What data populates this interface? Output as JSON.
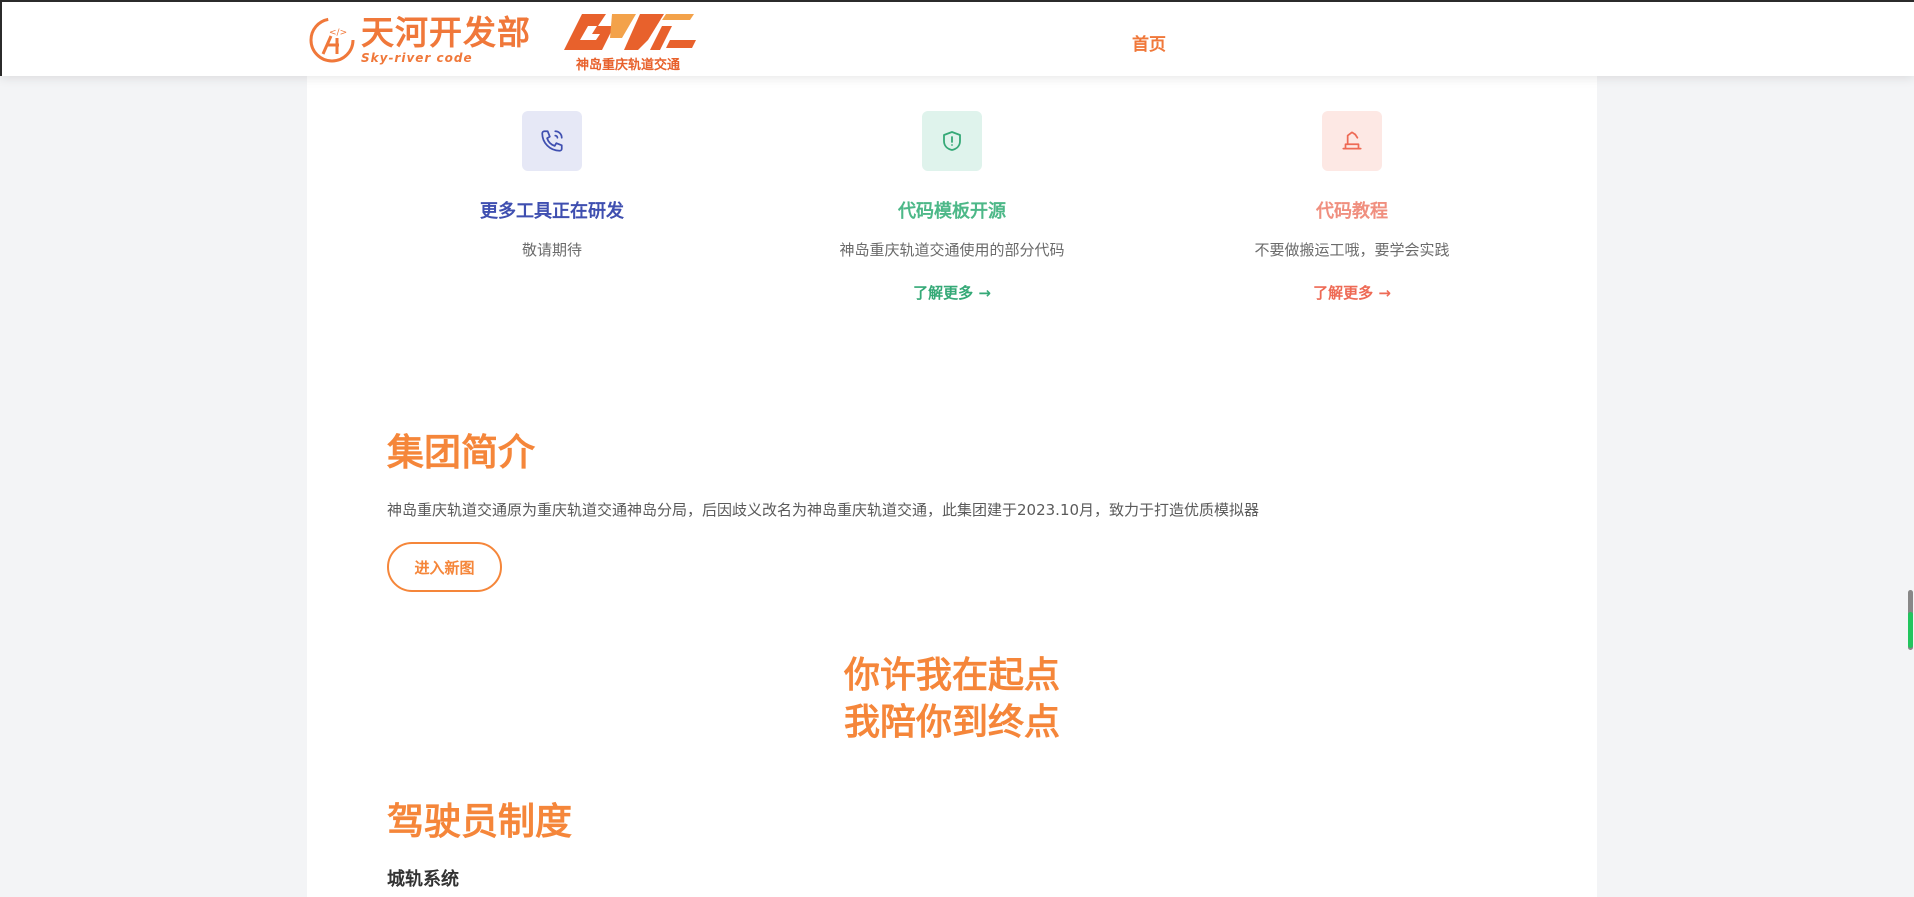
{
  "header": {
    "logo_cn": "天河开发部",
    "logo_en": "Sky-river code",
    "logo2_sub": "神岛重庆轨道交通",
    "nav_home": "首页"
  },
  "features": [
    {
      "title": "更多工具正在研发",
      "desc": "敬请期待",
      "icon": "phone-icon"
    },
    {
      "title": "代码模板开源",
      "desc": "神岛重庆轨道交通使用的部分代码",
      "more": "了解更多 →",
      "icon": "shield-icon"
    },
    {
      "title": "代码教程",
      "desc": "不要做搬运工哦，要学会实践",
      "more": "了解更多 →",
      "icon": "lamp-icon"
    }
  ],
  "intro": {
    "title": "集团简介",
    "text": "神岛重庆轨道交通原为重庆轨道交通神岛分局，后因歧义改名为神岛重庆轨道交通，此集团建于2023.10月，致力于打造优质模拟器",
    "button": "进入新图"
  },
  "slogan": {
    "line1": "你许我在起点",
    "line2": "我陪你到终点"
  },
  "driver": {
    "title": "驾驶员制度",
    "subtitle": "城轨系统"
  },
  "colors": {
    "accent": "#f5863a",
    "blue": "#3f4fb0",
    "green": "#35a977",
    "coral": "#ee6a55"
  }
}
